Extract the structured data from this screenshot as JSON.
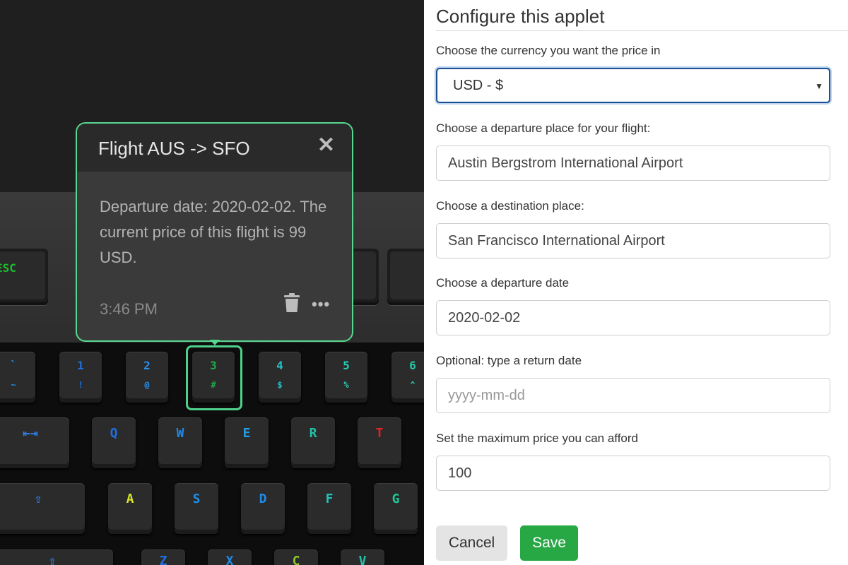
{
  "popup": {
    "title": "Flight AUS -> SFO",
    "close_glyph": "✕",
    "body": "Departure date: 2020-02-02. The current price of this flight is 99 USD.",
    "time": "3:46 PM",
    "more_glyph": "•••"
  },
  "keyboard": {
    "esc": "ESC",
    "number_row": [
      {
        "primary": "`",
        "secondary": "~",
        "color": "#1f8fe0"
      },
      {
        "primary": "1",
        "secondary": "!",
        "color": "#1f6fe0"
      },
      {
        "primary": "2",
        "secondary": "@",
        "color": "#2a8ee8"
      },
      {
        "primary": "3",
        "secondary": "#",
        "color": "#22a84a"
      },
      {
        "primary": "4",
        "secondary": "$",
        "color": "#22c1c8"
      },
      {
        "primary": "5",
        "secondary": "%",
        "color": "#24d0b8"
      },
      {
        "primary": "6",
        "secondary": "^",
        "color": "#26c8a8"
      }
    ],
    "qwerty_row": [
      {
        "primary": "⇤⇥",
        "color": "#2a7de8"
      },
      {
        "primary": "Q",
        "color": "#1f6fe0"
      },
      {
        "primary": "W",
        "color": "#1f8be8"
      },
      {
        "primary": "E",
        "color": "#1f9fe8"
      },
      {
        "primary": "R",
        "color": "#22c1a8"
      },
      {
        "primary": "T",
        "color": "#e02424"
      }
    ],
    "home_row": [
      {
        "primary": "⇧",
        "color": "#2a7de8"
      },
      {
        "primary": "A",
        "color": "#d8e62a"
      },
      {
        "primary": "S",
        "color": "#1f8fe8"
      },
      {
        "primary": "D",
        "color": "#1f8be8"
      },
      {
        "primary": "F",
        "color": "#22c1b8"
      },
      {
        "primary": "G",
        "color": "#22c89a"
      }
    ],
    "bottom_row": [
      {
        "primary": "⇧",
        "color": "#2a7de8"
      },
      {
        "primary": "Z",
        "color": "#1f6fe0"
      },
      {
        "primary": "X",
        "color": "#1f8be8"
      },
      {
        "primary": "C",
        "color": "#8ac82a"
      },
      {
        "primary": "V",
        "color": "#22c1a8"
      }
    ]
  },
  "config": {
    "title": "Configure this applet",
    "currency_label": "Choose the currency you want the price in",
    "currency_value": "USD - $",
    "departure_label": "Choose a departure place for your flight:",
    "departure_value": "Austin Bergstrom International Airport",
    "destination_label": "Choose a destination place:",
    "destination_value": "San Francisco International Airport",
    "date_label": "Choose a departure date",
    "date_value": "2020-02-02",
    "return_label": "Optional: type a return date",
    "return_placeholder": "yyyy-mm-dd",
    "max_price_label": "Set the maximum price you can afford",
    "max_price_value": "100",
    "cancel_label": "Cancel",
    "save_label": "Save"
  },
  "colors": {
    "popup_border": "#56d88e",
    "save_button": "#28a745",
    "focus_border": "#1b4f8f"
  }
}
